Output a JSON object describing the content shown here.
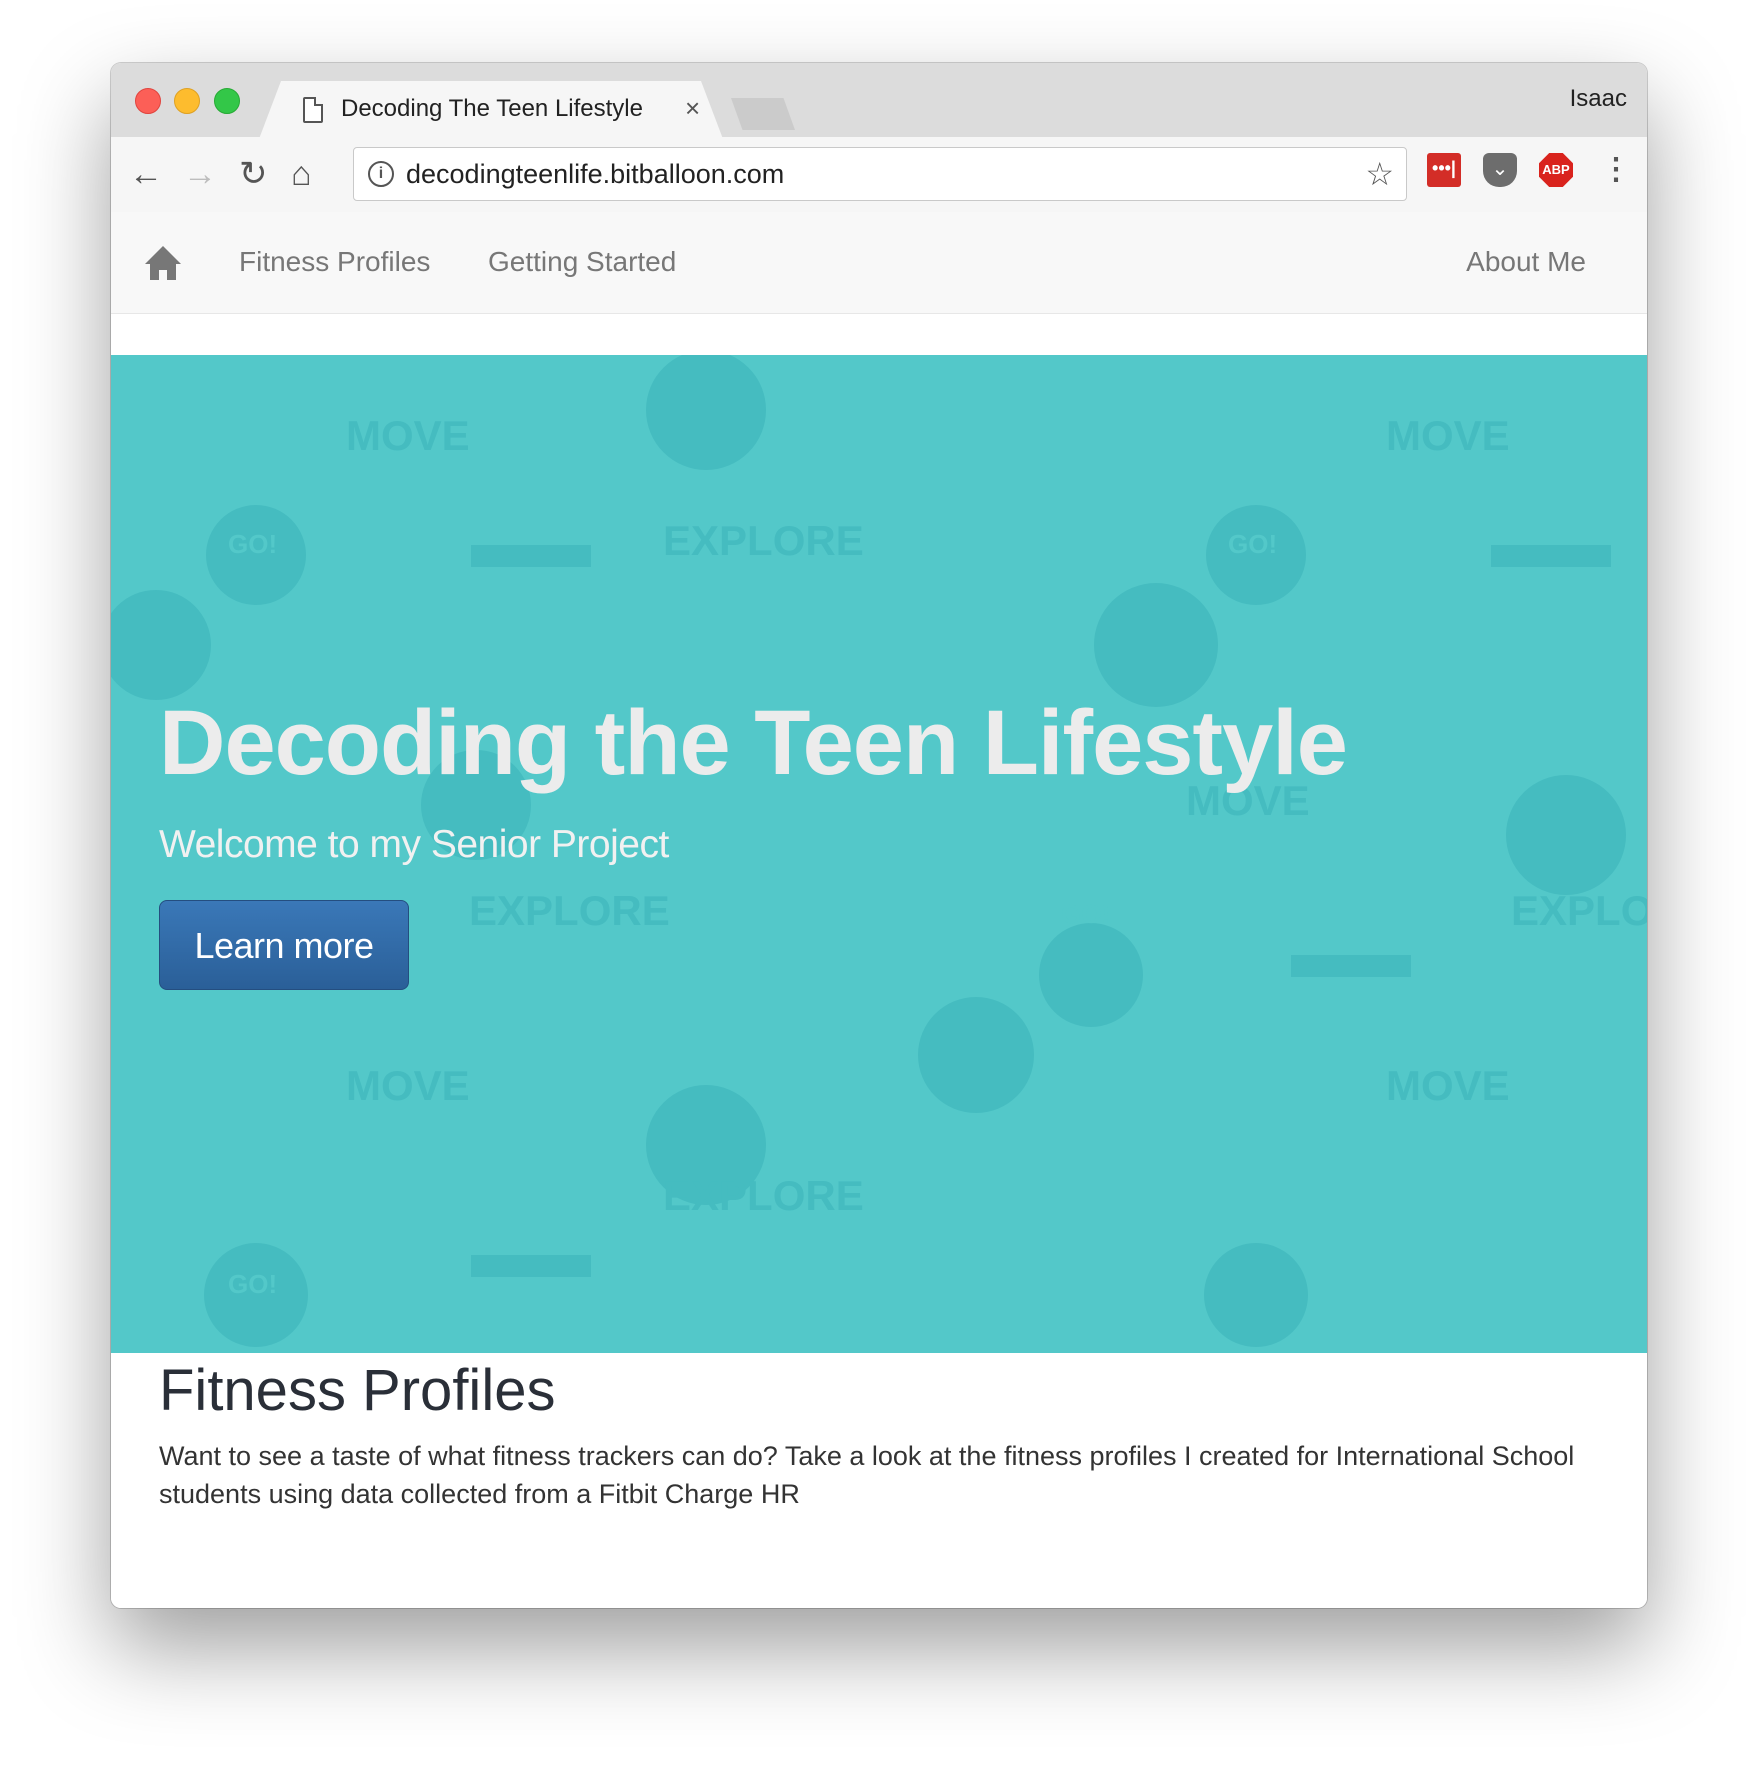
{
  "browser": {
    "tab_title": "Decoding The Teen Lifestyle",
    "tab_close": "×",
    "profile_name": "Isaac",
    "url": "decodingteenlife.bitballoon.com",
    "extensions": [
      "lastpass",
      "pocket",
      "adblock-plus"
    ],
    "ext_lastpass_label": "•••|",
    "ext_pocket_label": "⌄",
    "ext_abp_label": "ABP",
    "icons": {
      "back": "←",
      "forward": "→",
      "reload": "↻",
      "home": "⌂",
      "info": "i",
      "star": "☆",
      "menu": "⋮"
    }
  },
  "nav": {
    "items": [
      "Fitness Profiles",
      "Getting Started"
    ],
    "right_item": "About Me"
  },
  "hero": {
    "title": "Decoding the Teen Lifestyle",
    "subtitle": "Welcome to my Senior Project",
    "button_label": "Learn more",
    "background_color": "#53c8c9",
    "pattern_words": [
      "MOVE",
      "EXPLORE",
      "GO!"
    ]
  },
  "section": {
    "title": "Fitness Profiles",
    "text": "Want to see a taste of what fitness trackers can do? Take a look at the fitness profiles I created for International School students using data collected from a Fitbit Charge HR"
  }
}
